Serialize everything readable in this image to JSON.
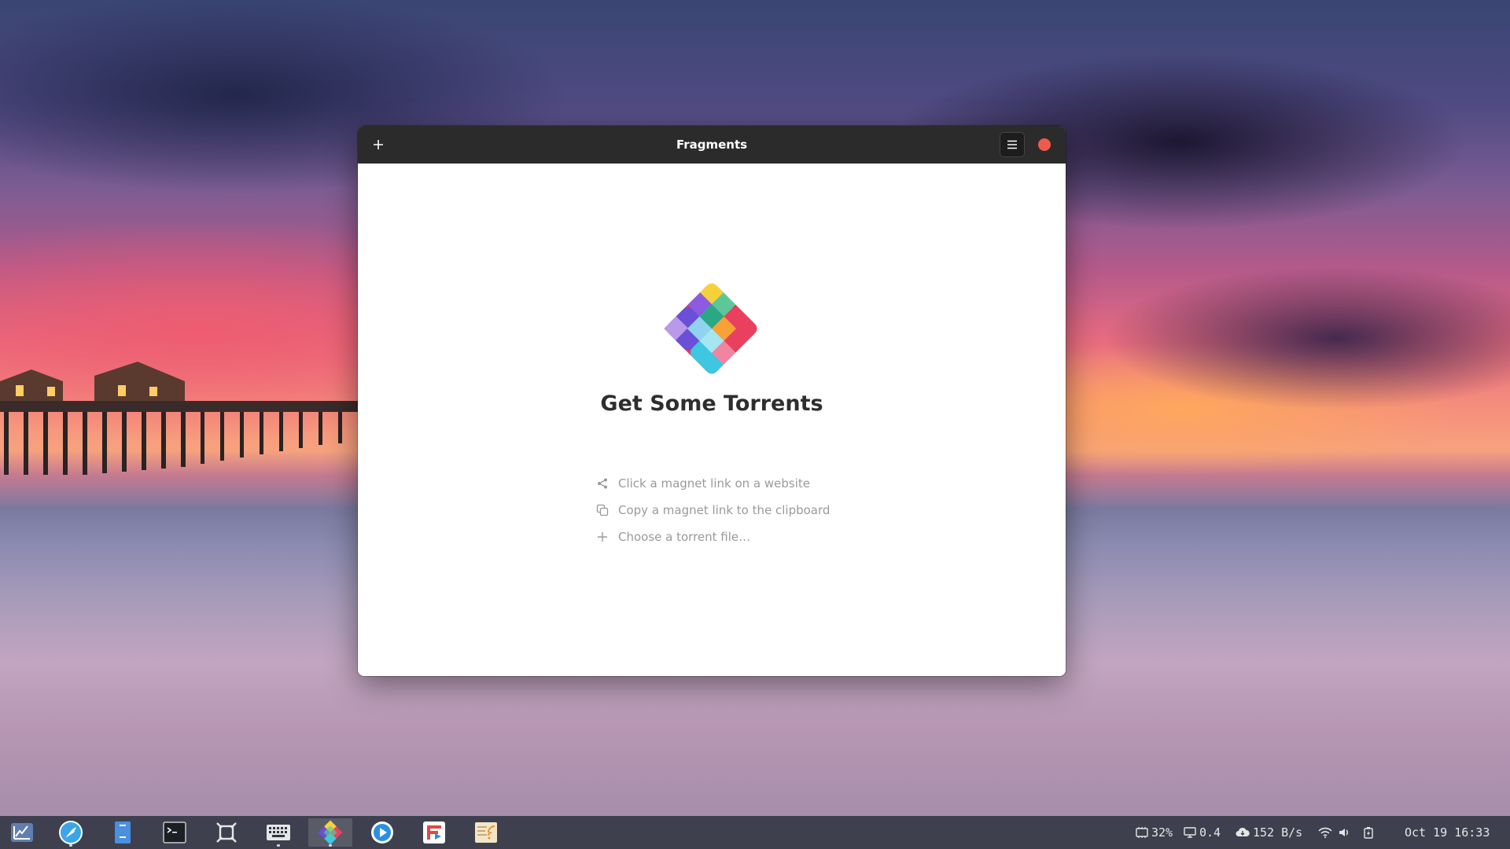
{
  "window": {
    "title": "Fragments",
    "add_icon": "plus-icon",
    "menu_icon": "hamburger-menu-icon",
    "close_color": "#ef5b4b"
  },
  "empty_state": {
    "title": "Get Some Torrents",
    "hints": [
      {
        "icon": "share-icon",
        "label": "Click a magnet link on a website"
      },
      {
        "icon": "copy-icon",
        "label": "Copy a magnet link to the clipboard"
      },
      {
        "icon": "plus-icon",
        "label": "Choose a torrent file…"
      }
    ]
  },
  "taskbar": {
    "apps": [
      {
        "name": "app-menu-icon"
      },
      {
        "name": "browser-icon"
      },
      {
        "name": "files-icon"
      },
      {
        "name": "terminal-icon"
      },
      {
        "name": "frame-icon"
      },
      {
        "name": "keyboard-icon"
      },
      {
        "name": "fragments-icon"
      },
      {
        "name": "media-player-icon"
      },
      {
        "name": "flathub-icon"
      },
      {
        "name": "feed-reader-icon"
      }
    ],
    "tray": {
      "cpu": "32%",
      "load": "0.4",
      "network": "152 B/s",
      "datetime": "Oct 19 16:33"
    }
  }
}
